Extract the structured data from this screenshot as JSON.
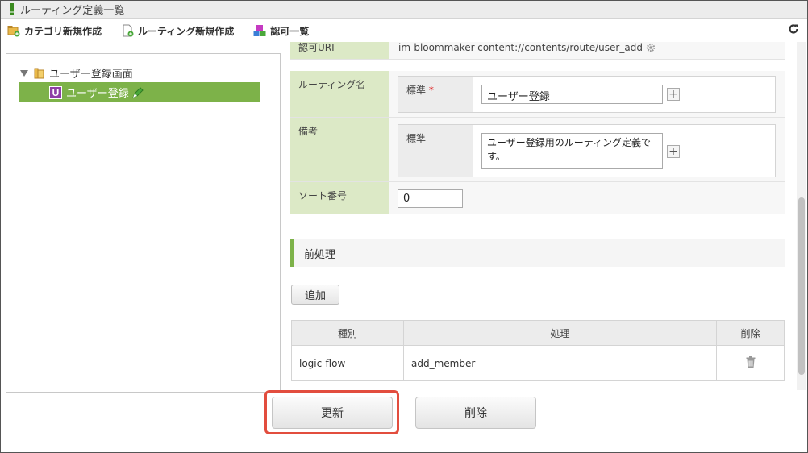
{
  "window": {
    "title": "ルーティング定義一覧"
  },
  "toolbar": {
    "new_category": "カテゴリ新規作成",
    "new_routing": "ルーティング新規作成",
    "permissions": "認可一覧"
  },
  "tree": {
    "root_label": "ユーザー登録画面",
    "selected_icon_letter": "U",
    "selected_label": "ユーザー登録"
  },
  "form": {
    "auth_uri_label": "認可URI",
    "auth_uri_value": "im-bloommaker-content://contents/route/user_add",
    "routing_name_label": "ルーティング名",
    "routing_name_sub_label": "標準",
    "routing_name_required": "*",
    "routing_name_value": "ユーザー登録",
    "note_label": "備考",
    "note_sub_label": "標準",
    "note_value": "ユーザー登録用のルーティング定義です。",
    "sort_label": "ソート番号",
    "sort_value": "0"
  },
  "preprocess": {
    "section_title": "前処理",
    "add_button": "追加",
    "columns": [
      "種別",
      "処理",
      "削除"
    ],
    "rows": [
      {
        "type": "logic-flow",
        "process": "add_member"
      }
    ]
  },
  "actions": {
    "update": "更新",
    "delete": "削除"
  },
  "colors": {
    "accent_green": "#7db249",
    "header_green": "#dce9c6",
    "highlight_red": "#e24d3e"
  }
}
